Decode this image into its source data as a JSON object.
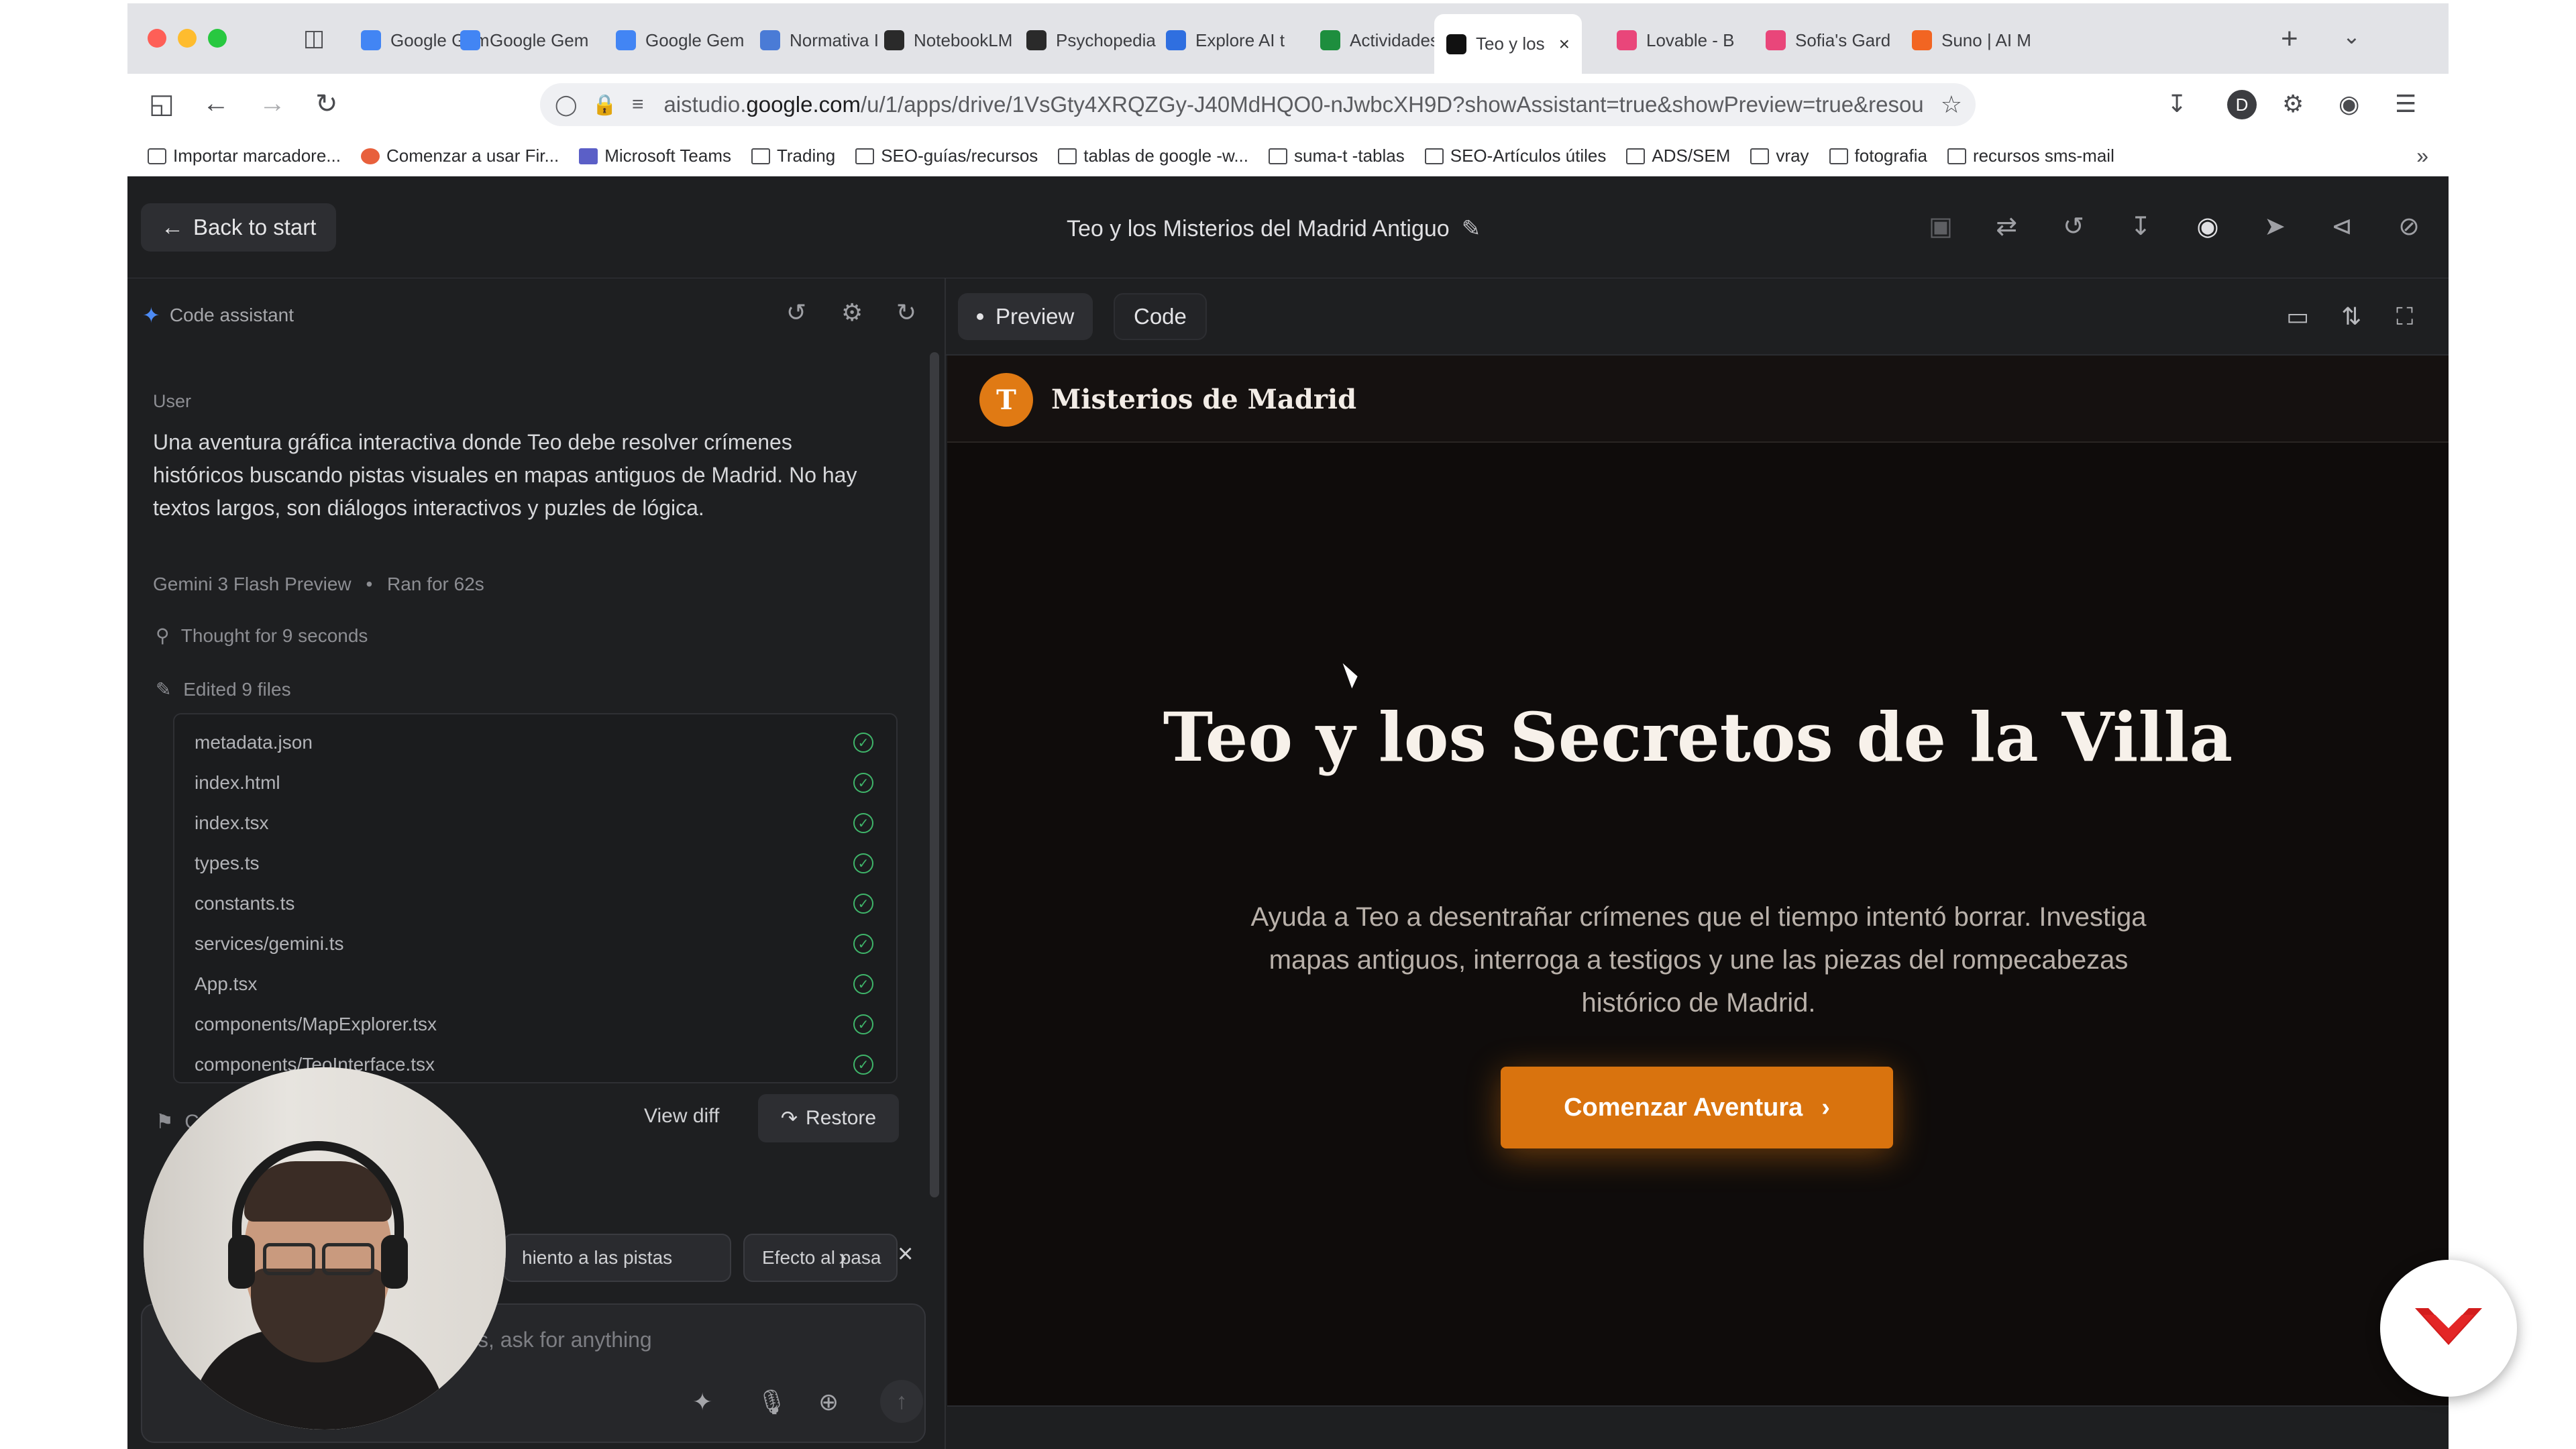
{
  "browser": {
    "tabs": [
      {
        "label": "Google Gem",
        "color": "#4285f4"
      },
      {
        "label": "Google Gem",
        "color": "#4285f4"
      },
      {
        "label": "Google Gem",
        "color": "#4285f4"
      },
      {
        "label": "Normativa I",
        "color": "#4a7bd6"
      },
      {
        "label": "NotebookLM",
        "color": "#2a2a2a"
      },
      {
        "label": "Psychopedia",
        "color": "#2a2a2a"
      },
      {
        "label": "Explore AI t",
        "color": "#2f6fe0"
      },
      {
        "label": "Actividades",
        "color": "#1e8e3e"
      },
      {
        "label": "Teo y los",
        "color": "#111111"
      },
      {
        "label": "Lovable - B",
        "color": "#e9467a"
      },
      {
        "label": "Sofia's Gard",
        "color": "#e9467a"
      },
      {
        "label": "Suno | AI M",
        "color": "#f26522"
      }
    ],
    "active_tab_index": 8,
    "url_prefix": "aistudio.",
    "url_domain": "google.com",
    "url_rest": "/u/1/apps/drive/1VsGty4XRQZGy-J40MdHQO0-nJwbcXH9D?showAssistant=true&showPreview=true&resou",
    "profile_letter": "D",
    "bookmarks": [
      {
        "label": "Importar marcadore...",
        "kind": "import"
      },
      {
        "label": "Comenzar a usar Fir...",
        "kind": "firefox"
      },
      {
        "label": "Microsoft Teams",
        "kind": "teams"
      },
      {
        "label": "Trading",
        "kind": "folder"
      },
      {
        "label": "SEO-guías/recursos",
        "kind": "folder"
      },
      {
        "label": "tablas de google -w...",
        "kind": "folder"
      },
      {
        "label": "suma-t -tablas",
        "kind": "folder"
      },
      {
        "label": "SEO-Artículos útiles",
        "kind": "folder"
      },
      {
        "label": "ADS/SEM",
        "kind": "folder"
      },
      {
        "label": "vray",
        "kind": "folder"
      },
      {
        "label": "fotografia",
        "kind": "folder"
      },
      {
        "label": "recursos sms-mail",
        "kind": "folder"
      }
    ]
  },
  "app": {
    "back_label": "Back to start",
    "title": "Teo y los Misterios del Madrid Antiguo"
  },
  "assistant": {
    "title": "Code assistant",
    "user_label": "User",
    "user_message": "Una aventura gráfica interactiva donde Teo debe resolver crímenes históricos buscando pistas visuales en mapas antiguos de Madrid. No hay textos largos, son diálogos interactivos y puzles de lógica.",
    "model": "Gemini 3 Flash Preview",
    "ran_for": "Ran for 62s",
    "thought": "Thought for 9 seconds",
    "edited": "Edited 9 files",
    "files": [
      "metadata.json",
      "index.html",
      "index.tsx",
      "types.ts",
      "constants.ts",
      "services/gemini.ts",
      "App.tsx",
      "components/MapExplorer.tsx",
      "components/TeoInterface.tsx"
    ],
    "checkpoint_label": "C",
    "view_diff": "View diff",
    "restore": "Restore",
    "suggestions": [
      "hiento a las pistas",
      "Efecto al pasa"
    ],
    "input_placeholder": "s, ask for anything"
  },
  "preview": {
    "tabs": {
      "preview": "Preview",
      "code": "Code"
    },
    "site_logo_letter": "T",
    "site_brand": "Misterios de Madrid",
    "hero_title": "Teo y los Secretos de la Villa",
    "hero_subtitle": "Ayuda a Teo a desentrañar crímenes que el tiempo intentó borrar. Investiga mapas antiguos, interroga a testigos y une las piezas del rompecabezas histórico de Madrid.",
    "cta_label": "Comenzar Aventura",
    "accent": "#d9730e"
  }
}
